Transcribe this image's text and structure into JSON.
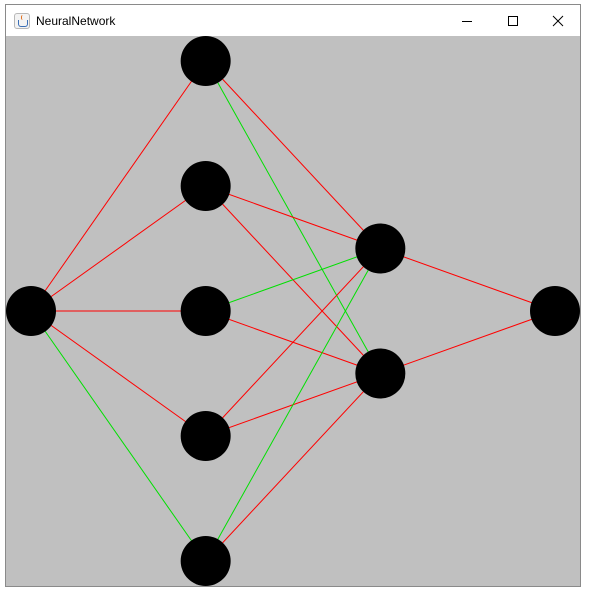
{
  "window": {
    "title": "NeuralNetwork",
    "icon": "java-cup-icon",
    "controls": [
      "minimize-icon",
      "maximize-icon",
      "close-icon"
    ]
  },
  "canvas": {
    "background": "#c0c0c0",
    "neuron_color": "#000000",
    "positive_color": "#00e000",
    "negative_color": "#ff0000"
  },
  "network": {
    "layers": [
      1,
      5,
      2,
      1
    ],
    "connections": [
      {
        "from": [
          0,
          0
        ],
        "to": [
          1,
          0
        ],
        "sign": "negative"
      },
      {
        "from": [
          0,
          0
        ],
        "to": [
          1,
          1
        ],
        "sign": "negative"
      },
      {
        "from": [
          0,
          0
        ],
        "to": [
          1,
          2
        ],
        "sign": "negative"
      },
      {
        "from": [
          0,
          0
        ],
        "to": [
          1,
          3
        ],
        "sign": "negative"
      },
      {
        "from": [
          0,
          0
        ],
        "to": [
          1,
          4
        ],
        "sign": "positive"
      },
      {
        "from": [
          1,
          0
        ],
        "to": [
          2,
          0
        ],
        "sign": "negative"
      },
      {
        "from": [
          1,
          0
        ],
        "to": [
          2,
          1
        ],
        "sign": "positive"
      },
      {
        "from": [
          1,
          1
        ],
        "to": [
          2,
          0
        ],
        "sign": "negative"
      },
      {
        "from": [
          1,
          1
        ],
        "to": [
          2,
          1
        ],
        "sign": "negative"
      },
      {
        "from": [
          1,
          2
        ],
        "to": [
          2,
          0
        ],
        "sign": "positive"
      },
      {
        "from": [
          1,
          2
        ],
        "to": [
          2,
          1
        ],
        "sign": "negative"
      },
      {
        "from": [
          1,
          3
        ],
        "to": [
          2,
          0
        ],
        "sign": "negative"
      },
      {
        "from": [
          1,
          3
        ],
        "to": [
          2,
          1
        ],
        "sign": "negative"
      },
      {
        "from": [
          1,
          4
        ],
        "to": [
          2,
          0
        ],
        "sign": "positive"
      },
      {
        "from": [
          1,
          4
        ],
        "to": [
          2,
          1
        ],
        "sign": "negative"
      },
      {
        "from": [
          2,
          0
        ],
        "to": [
          3,
          0
        ],
        "sign": "negative"
      },
      {
        "from": [
          2,
          1
        ],
        "to": [
          3,
          0
        ],
        "sign": "negative"
      }
    ]
  }
}
